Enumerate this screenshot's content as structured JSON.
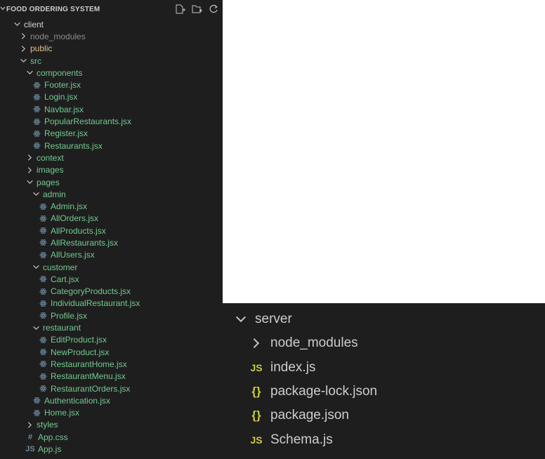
{
  "explorer": {
    "title": "FOOD ORDERING SYSTEM",
    "header_actions": [
      "new-file-icon",
      "new-folder-icon",
      "refresh-icon"
    ]
  },
  "tree": [
    {
      "label": "client",
      "type": "folder",
      "open": true,
      "depth": 0,
      "color": "folder"
    },
    {
      "label": "node_modules",
      "type": "folder",
      "open": false,
      "depth": 1,
      "color": "gray"
    },
    {
      "label": "public",
      "type": "folder",
      "open": false,
      "depth": 1,
      "color": "yellow"
    },
    {
      "label": "src",
      "type": "folder",
      "open": true,
      "depth": 1,
      "color": "green"
    },
    {
      "label": "components",
      "type": "folder",
      "open": true,
      "depth": 2,
      "color": "green"
    },
    {
      "label": "Footer.jsx",
      "type": "file",
      "icon": "react",
      "depth": 3,
      "color": "green"
    },
    {
      "label": "Login.jsx",
      "type": "file",
      "icon": "react",
      "depth": 3,
      "color": "green"
    },
    {
      "label": "Navbar.jsx",
      "type": "file",
      "icon": "react",
      "depth": 3,
      "color": "green"
    },
    {
      "label": "PopularRestaurants.jsx",
      "type": "file",
      "icon": "react",
      "depth": 3,
      "color": "green"
    },
    {
      "label": "Register.jsx",
      "type": "file",
      "icon": "react",
      "depth": 3,
      "color": "green"
    },
    {
      "label": "Restaurants.jsx",
      "type": "file",
      "icon": "react",
      "depth": 3,
      "color": "green"
    },
    {
      "label": "context",
      "type": "folder",
      "open": false,
      "depth": 2,
      "color": "green"
    },
    {
      "label": "images",
      "type": "folder",
      "open": false,
      "depth": 2,
      "color": "green"
    },
    {
      "label": "pages",
      "type": "folder",
      "open": true,
      "depth": 2,
      "color": "green"
    },
    {
      "label": "admin",
      "type": "folder",
      "open": true,
      "depth": 3,
      "color": "green"
    },
    {
      "label": "Admin.jsx",
      "type": "file",
      "icon": "react",
      "depth": 4,
      "color": "green"
    },
    {
      "label": "AllOrders.jsx",
      "type": "file",
      "icon": "react",
      "depth": 4,
      "color": "green"
    },
    {
      "label": "AllProducts.jsx",
      "type": "file",
      "icon": "react",
      "depth": 4,
      "color": "green"
    },
    {
      "label": "AllRestaurants.jsx",
      "type": "file",
      "icon": "react",
      "depth": 4,
      "color": "green"
    },
    {
      "label": "AllUsers.jsx",
      "type": "file",
      "icon": "react",
      "depth": 4,
      "color": "green"
    },
    {
      "label": "customer",
      "type": "folder",
      "open": true,
      "depth": 3,
      "color": "green"
    },
    {
      "label": "Cart.jsx",
      "type": "file",
      "icon": "react",
      "depth": 4,
      "color": "green"
    },
    {
      "label": "CategoryProducts.jsx",
      "type": "file",
      "icon": "react",
      "depth": 4,
      "color": "green"
    },
    {
      "label": "IndividualRestaurant.jsx",
      "type": "file",
      "icon": "react",
      "depth": 4,
      "color": "green"
    },
    {
      "label": "Profile.jsx",
      "type": "file",
      "icon": "react",
      "depth": 4,
      "color": "green"
    },
    {
      "label": "restaurant",
      "type": "folder",
      "open": true,
      "depth": 3,
      "color": "green"
    },
    {
      "label": "EditProduct.jsx",
      "type": "file",
      "icon": "react",
      "depth": 4,
      "color": "green"
    },
    {
      "label": "NewProduct.jsx",
      "type": "file",
      "icon": "react",
      "depth": 4,
      "color": "green"
    },
    {
      "label": "RestaurantHome.jsx",
      "type": "file",
      "icon": "react",
      "depth": 4,
      "color": "green"
    },
    {
      "label": "RestaurantMenu.jsx",
      "type": "file",
      "icon": "react",
      "depth": 4,
      "color": "green"
    },
    {
      "label": "RestaurantOrders.jsx",
      "type": "file",
      "icon": "react",
      "depth": 4,
      "color": "green"
    },
    {
      "label": "Authentication.jsx",
      "type": "file",
      "icon": "react",
      "depth": 3,
      "color": "green"
    },
    {
      "label": "Home.jsx",
      "type": "file",
      "icon": "react",
      "depth": 3,
      "color": "green"
    },
    {
      "label": "styles",
      "type": "folder",
      "open": false,
      "depth": 2,
      "color": "green"
    },
    {
      "label": "App.css",
      "type": "file",
      "icon": "css",
      "depth": 2,
      "color": "green"
    },
    {
      "label": "App.js",
      "type": "file",
      "icon": "js",
      "depth": 2,
      "color": "green"
    }
  ],
  "server_tree": [
    {
      "label": "server",
      "type": "folder",
      "open": true,
      "depth": 0
    },
    {
      "label": "node_modules",
      "type": "folder",
      "open": false,
      "depth": 1
    },
    {
      "label": "index.js",
      "type": "file",
      "icon": "js",
      "depth": 1
    },
    {
      "label": "package-lock.json",
      "type": "file",
      "icon": "json",
      "depth": 1
    },
    {
      "label": "package.json",
      "type": "file",
      "icon": "json",
      "depth": 1
    },
    {
      "label": "Schema.js",
      "type": "file",
      "icon": "js",
      "depth": 1
    }
  ],
  "colors": {
    "background": "#1e1e1e",
    "green": "#73c991",
    "gray": "#8c8c8c",
    "yellow": "#e2c08d",
    "js_icon": "#cbcb41",
    "css_icon": "#519aba"
  }
}
